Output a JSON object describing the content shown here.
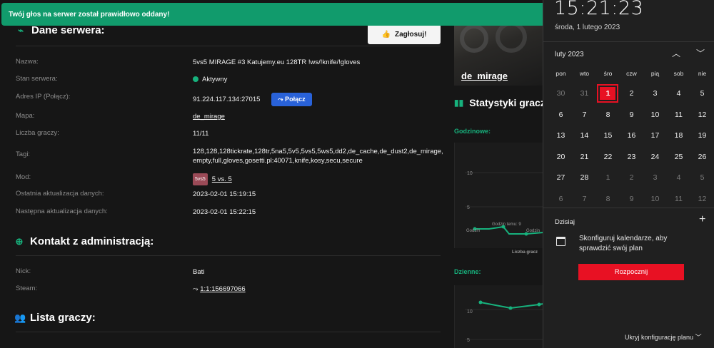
{
  "toast": {
    "message": "Twój głos na serwer został prawidłowo oddany!"
  },
  "vote": {
    "label": "Zagłosuj!"
  },
  "server_section": {
    "title": "Dane serwera:",
    "rows": [
      {
        "label": "Nazwa:",
        "value": "5vs5 MIRAGE #3 Katujemy.eu 128TR !ws/!knife/!gloves"
      },
      {
        "label": "Stan serwera:",
        "value": "Aktywny"
      },
      {
        "label": "Adres IP (Połącz):",
        "value": "91.224.117.134:27015",
        "button": "Połącz"
      },
      {
        "label": "Mapa:",
        "value": "de_mirage"
      },
      {
        "label": "Liczba graczy:",
        "value": "11/11"
      },
      {
        "label": "Tagi:",
        "value": "128,128,128tickrate,128tr,5na5,5v5,5vs5,5ws5,dd2,de_cache,de_dust2,de_mirage,empty,full,gloves,gosetti.pl:40071,knife,kosy,secu,secure"
      },
      {
        "label": "Mod:",
        "badge": "5vs5",
        "value": "5 vs. 5"
      },
      {
        "label": "Ostatnia aktualizacja danych:",
        "value": "2023-02-01 15:19:15"
      },
      {
        "label": "Następna aktualizacja danych:",
        "value": "2023-02-01 15:22:15"
      }
    ]
  },
  "admin_section": {
    "title": "Kontakt z administracją:",
    "rows": [
      {
        "label": "Nick:",
        "value": "Bati"
      },
      {
        "label": "Steam:",
        "value": "1:1:156697066"
      }
    ]
  },
  "players_section": {
    "title": "Lista graczy:"
  },
  "map_card": {
    "name": "de_mirage"
  },
  "stats": {
    "title": "Statystyki gracz",
    "hourly_label": "Godzinowe:",
    "daily_label": "Dzienne:",
    "hourly_ticks": [
      "10",
      "5"
    ],
    "hourly_annotations": [
      "Godzin temu: 9",
      "Godzin",
      "Godzin"
    ],
    "hourly_xlabel": "Liczba gracz",
    "daily_ticks": [
      "10",
      "5"
    ]
  },
  "flyout": {
    "time": "15:21:23",
    "date": "środa, 1 lutego 2023",
    "month": "luty 2023",
    "weekdays": [
      "pon",
      "wto",
      "śro",
      "czw",
      "pią",
      "sob",
      "nie"
    ],
    "weeks": [
      [
        "30",
        "31",
        "1",
        "2",
        "3",
        "4",
        "5"
      ],
      [
        "6",
        "7",
        "8",
        "9",
        "10",
        "11",
        "12"
      ],
      [
        "13",
        "14",
        "15",
        "16",
        "17",
        "18",
        "19"
      ],
      [
        "20",
        "21",
        "22",
        "23",
        "24",
        "25",
        "26"
      ],
      [
        "27",
        "28",
        "1",
        "2",
        "3",
        "4",
        "5"
      ],
      [
        "6",
        "7",
        "8",
        "9",
        "10",
        "11",
        "12"
      ]
    ],
    "today_label": "Dzisiaj",
    "agenda_text": "Skonfiguruj kalendarze, aby sprawdzić swój plan",
    "start_button": "Rozpocznij",
    "hide_link": "Ukryj konfigurację planu",
    "accent": "#e81123"
  },
  "colors": {
    "accent_green": "#17b27d",
    "connect_blue": "#2962d9",
    "toast_green": "#119b6c"
  }
}
